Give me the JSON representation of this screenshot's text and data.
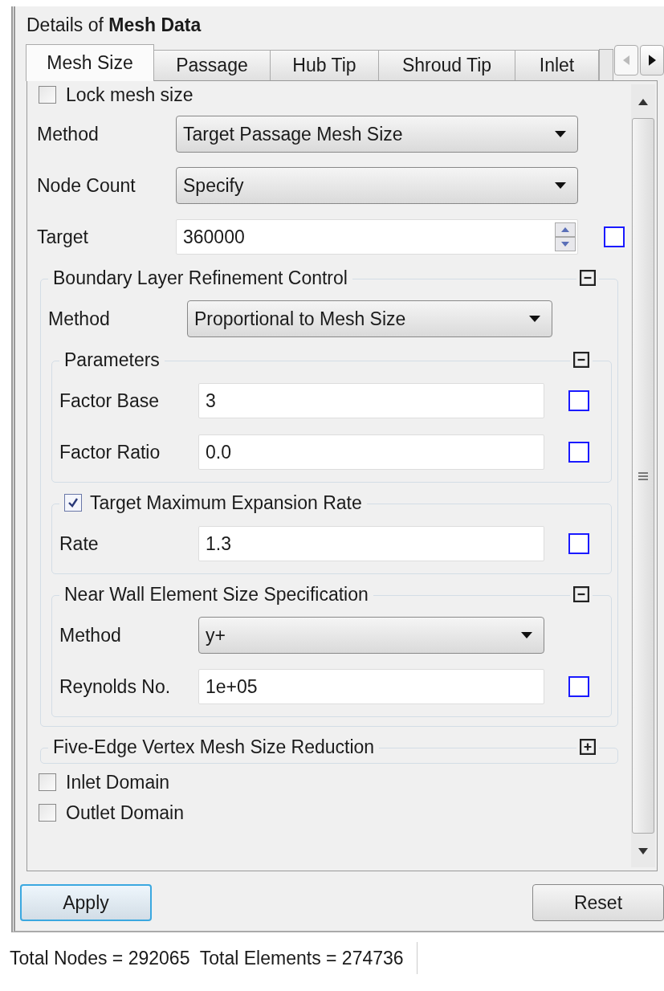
{
  "panel": {
    "title": "Details of **Mesh Data**"
  },
  "tabs": [
    {
      "label": "Mesh Size",
      "selected": true
    },
    {
      "label": "Passage",
      "selected": false
    },
    {
      "label": "Hub Tip",
      "selected": false
    },
    {
      "label": "Shroud Tip",
      "selected": false
    },
    {
      "label": "Inlet",
      "selected": false
    }
  ],
  "form": [
    {
      "kind": "checkbox",
      "label": "Lock mesh size",
      "checked": false
    },
    {
      "kind": "dropdown",
      "label": "Method",
      "value": "Target Passage Mesh Size"
    },
    {
      "kind": "dropdown",
      "label": "Node Count",
      "value": "Specify"
    },
    {
      "kind": "spinner",
      "label": "Target",
      "value": "360000"
    },
    {
      "kind": "group",
      "title": "Boundary Layer Refinement Control",
      "expanded": true,
      "items": [
        {
          "kind": "dropdown",
          "label": "Method",
          "value": "Proportional to Mesh Size"
        },
        {
          "kind": "group",
          "title": "Parameters",
          "expanded": true,
          "items": [
            {
              "kind": "input",
              "label": "Factor Base",
              "value": "3"
            },
            {
              "kind": "input",
              "label": "Factor Ratio",
              "value": "0.0"
            }
          ]
        },
        {
          "kind": "checkgroup",
          "title": "Target Maximum Expansion Rate",
          "checked": true,
          "items": [
            {
              "kind": "input",
              "label": "Rate",
              "value": "1.3"
            }
          ]
        },
        {
          "kind": "group",
          "title": "Near Wall Element Size Specification",
          "expanded": true,
          "items": [
            {
              "kind": "dropdown",
              "label": "Method",
              "value": "y+"
            },
            {
              "kind": "input",
              "label": "Reynolds No.",
              "value": "1e+05"
            }
          ]
        }
      ]
    },
    {
      "kind": "group",
      "title": "Five-Edge Vertex Mesh Size Reduction",
      "expanded": false
    },
    {
      "kind": "checkbox",
      "label": "Inlet Domain",
      "checked": false
    },
    {
      "kind": "checkbox",
      "label": "Outlet Domain",
      "checked": false
    }
  ],
  "buttons": [
    {
      "label": "Apply",
      "focused": true
    },
    {
      "label": "Reset",
      "focused": false
    }
  ],
  "status_bar": {
    "text": "Total Nodes = 292065  Total Elements = 274736"
  }
}
